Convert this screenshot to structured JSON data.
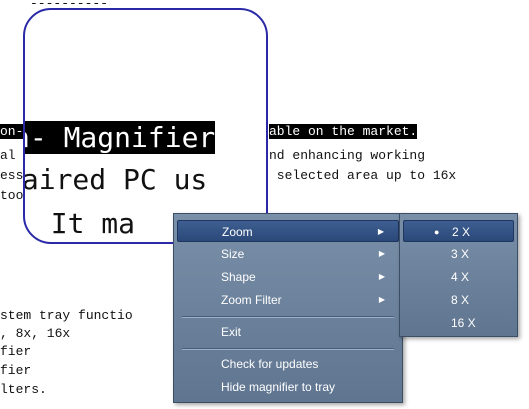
{
  "document": {
    "dashes": "------------",
    "lines": [
      "on-",
      "al",
      "ess",
      "too",
      "stem tray functio",
      ", 8x, 16x",
      "fier",
      "fier",
      "lters."
    ],
    "right_lines": [
      "able on the market.",
      "nd enhancing working",
      " selected area up to 16x"
    ]
  },
  "magnifier": {
    "line1": "n- Magnifier",
    "line2": "paired PC us",
    "line3": ". It ma"
  },
  "context_menu": {
    "items": [
      {
        "label": "Zoom",
        "has_submenu": true
      },
      {
        "label": "Size",
        "has_submenu": true
      },
      {
        "label": "Shape",
        "has_submenu": true
      },
      {
        "label": "Zoom Filter",
        "has_submenu": true
      },
      {
        "label": "Exit",
        "has_submenu": false
      },
      {
        "label": "Check for updates",
        "has_submenu": false
      },
      {
        "label": "Hide magnifier to tray",
        "has_submenu": false
      }
    ],
    "submenu_arrow": "▶"
  },
  "zoom_submenu": {
    "items": [
      "2 X",
      "3 X",
      "4 X",
      "8 X",
      "16 X"
    ],
    "selected": "2 X",
    "bullet": "●"
  },
  "colors": {
    "menu_bg": "#6f85a0",
    "menu_highlight": "#2f4d80",
    "lens_border": "#2a2aa8"
  }
}
